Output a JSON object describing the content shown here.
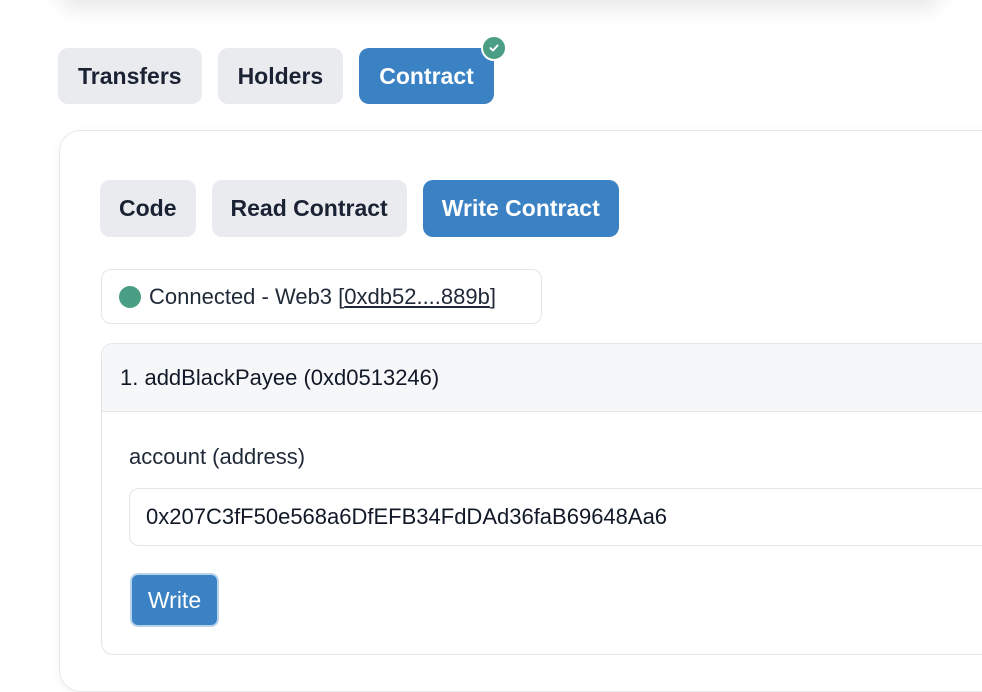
{
  "main_tabs": [
    {
      "label": "Transfers",
      "active": false
    },
    {
      "label": "Holders",
      "active": false
    },
    {
      "label": "Contract",
      "active": true,
      "badge_icon": "check-circle-icon"
    }
  ],
  "sub_tabs": [
    {
      "label": "Code",
      "active": false
    },
    {
      "label": "Read Contract",
      "active": false
    },
    {
      "label": "Write Contract",
      "active": true
    }
  ],
  "connection": {
    "status_text": "Connected - Web3 ",
    "address_open": "[",
    "address": "0xdb52....889b",
    "address_close": "]",
    "status_color": "#4a9e84"
  },
  "function": {
    "title": "1. addBlackPayee (0xd0513246)",
    "param_label": "account (address)",
    "param_value": "0x207C3fF50e568a6DfEFB34FdDAd36faB69648Aa6",
    "write_label": "Write"
  },
  "colors": {
    "accent": "#3b82c4",
    "tab_bg": "#e9ebef",
    "success": "#4a9e84"
  }
}
